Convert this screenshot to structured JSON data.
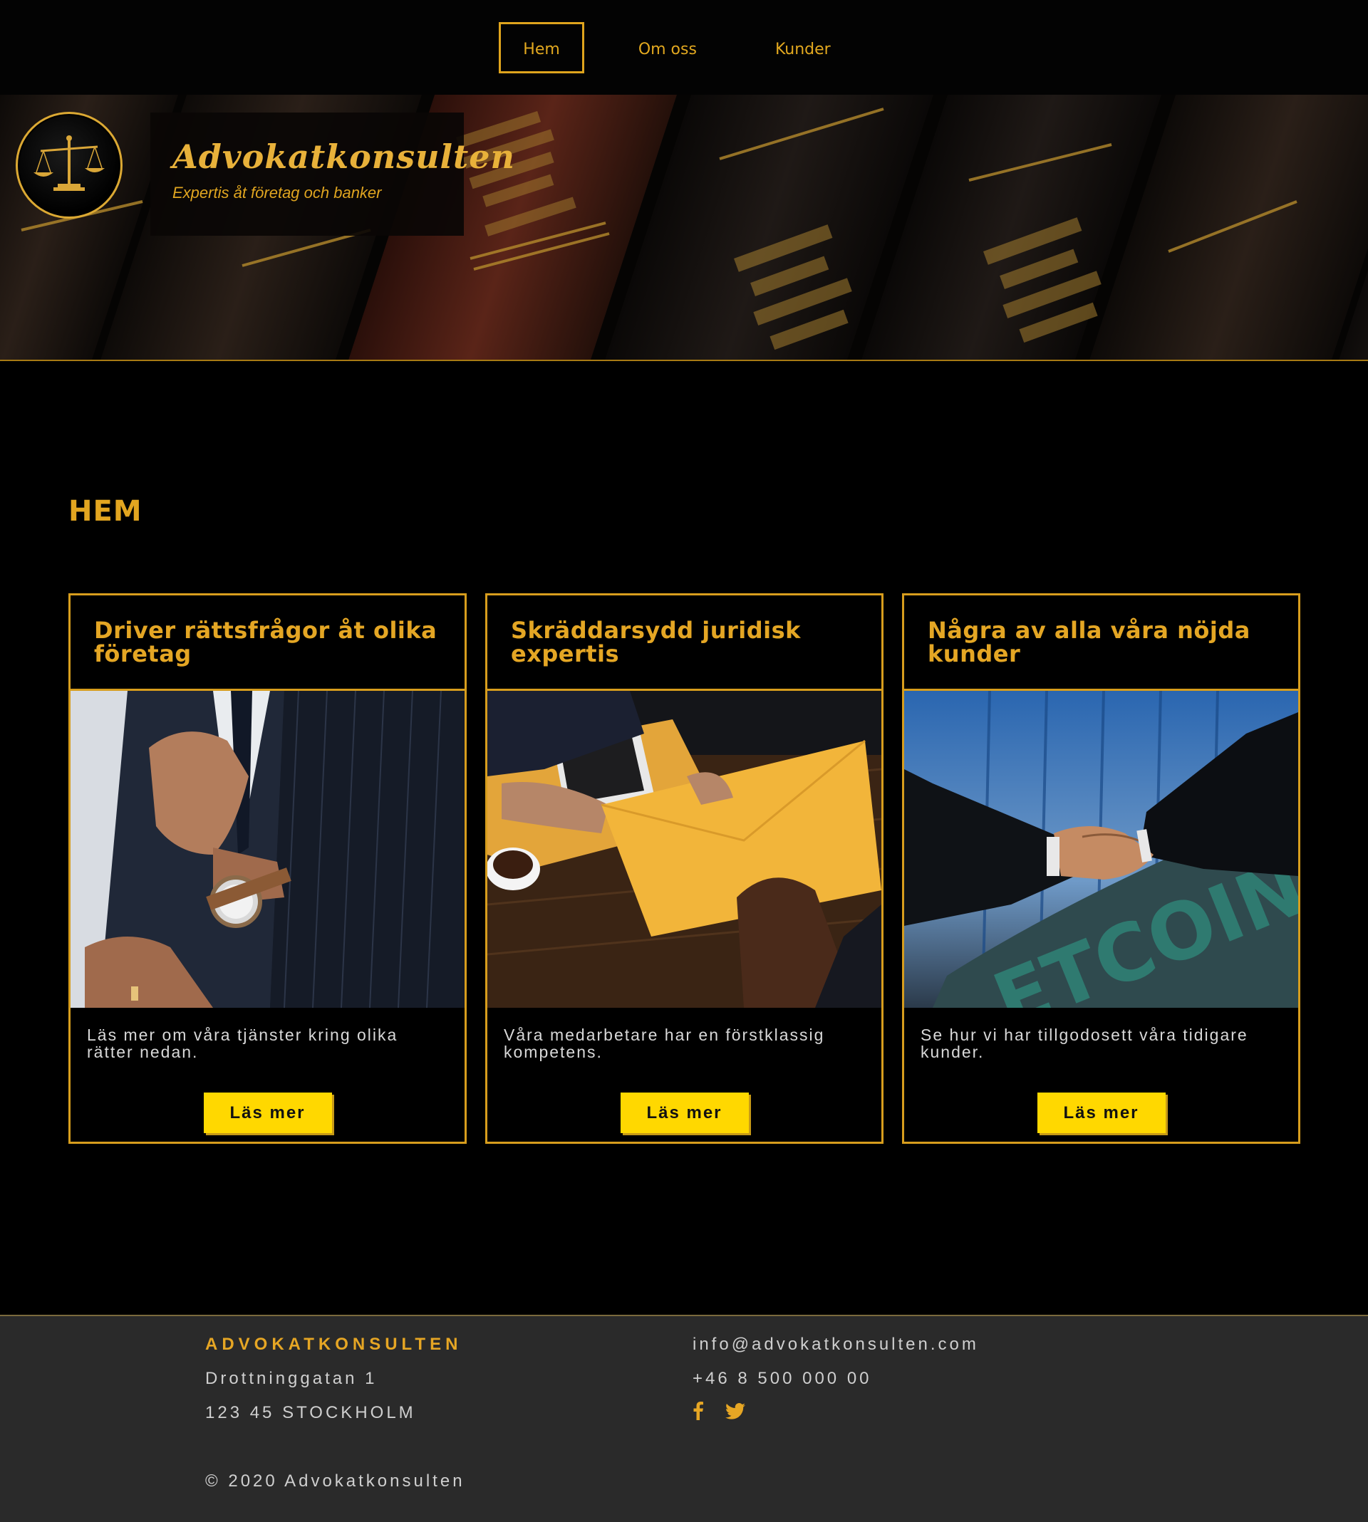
{
  "nav": {
    "items": [
      {
        "label": "Hem",
        "active": true
      },
      {
        "label": "Om oss",
        "active": false
      },
      {
        "label": "Kunder",
        "active": false
      }
    ]
  },
  "hero": {
    "logo_icon": "scales-of-justice-icon",
    "brand": "Advokatkonsulten",
    "tagline": "Expertis åt företag och banker"
  },
  "main": {
    "heading": "HEM",
    "cards": [
      {
        "title": "Driver rättsfrågor åt olika företag",
        "text": "Läs mer om våra tjänster kring olika rätter nedan.",
        "button": "Läs mer"
      },
      {
        "title": "Skräddarsydd juridisk expertis",
        "text": "Våra medarbetare har en förstklassig kompetens.",
        "button": "Läs mer"
      },
      {
        "title": "Några av alla våra nöjda kunder",
        "text": "Se hur vi har tillgodosett våra tidigare kunder.",
        "button": "Läs mer"
      }
    ]
  },
  "footer": {
    "brand": "ADVOKATKONSULTEN",
    "street": "Drottninggatan 1",
    "city": "123 45 STOCKHOLM",
    "email": "info@advokatkonsulten.com",
    "phone": "+46 8 500 000 00",
    "social": [
      "facebook-icon",
      "twitter-icon"
    ],
    "copyright": "© 2020 Advokatkonsulten"
  },
  "colors": {
    "accent": "#e2a520",
    "button": "#ffd800",
    "background": "#000000",
    "footer": "#2a2a2a"
  }
}
